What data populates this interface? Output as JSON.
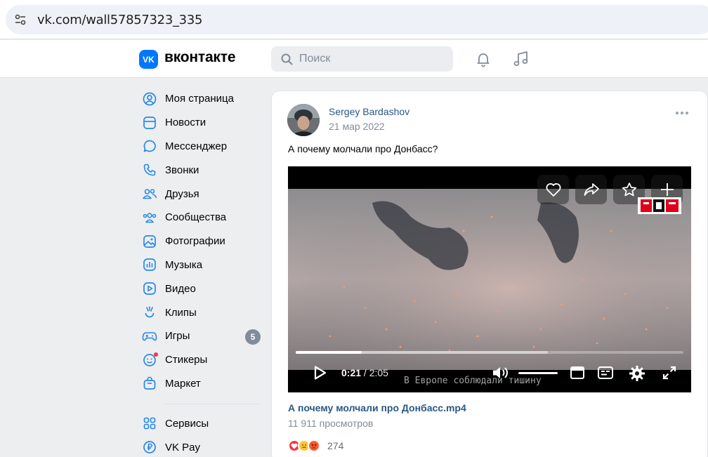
{
  "browser": {
    "url": "vk.com/wall57857323_335"
  },
  "header": {
    "logo_letter": "VK",
    "brand": "вконтакте",
    "search_placeholder": "Поиск"
  },
  "sidebar": {
    "items": [
      {
        "label": "Моя страница",
        "icon": "user-circle-icon"
      },
      {
        "label": "Новости",
        "icon": "news-icon"
      },
      {
        "label": "Мессенджер",
        "icon": "message-icon"
      },
      {
        "label": "Звонки",
        "icon": "phone-icon"
      },
      {
        "label": "Друзья",
        "icon": "friends-icon"
      },
      {
        "label": "Сообщества",
        "icon": "communities-icon"
      },
      {
        "label": "Фотографии",
        "icon": "photo-icon"
      },
      {
        "label": "Музыка",
        "icon": "music-icon"
      },
      {
        "label": "Видео",
        "icon": "video-icon"
      },
      {
        "label": "Клипы",
        "icon": "clips-icon"
      },
      {
        "label": "Игры",
        "icon": "gamepad-icon",
        "badge": "5"
      },
      {
        "label": "Стикеры",
        "icon": "sticker-icon"
      },
      {
        "label": "Маркет",
        "icon": "market-bag-icon"
      }
    ],
    "extra_items": [
      {
        "label": "Сервисы",
        "icon": "services-icon"
      },
      {
        "label": "VK Pay",
        "icon": "ruble-icon"
      }
    ]
  },
  "post": {
    "author": "Sergey Bardashov",
    "date": "21 мар 2022",
    "text": "А почему молчали про Донбасс?",
    "video": {
      "current_time": "0:21",
      "separator": " / ",
      "duration": "2:05",
      "progress": 0.17,
      "buffered": 0.65,
      "subtitle": "В Европе соблюдали тишину",
      "title": "А почему молчали про Донбасс.mp4",
      "views": "11 911 просмотров"
    },
    "reactions_count": "274"
  },
  "colors": {
    "accent": "#0077ff",
    "link": "#2a5885",
    "secondary_text": "#818c99",
    "page_bg": "#edeef0"
  }
}
